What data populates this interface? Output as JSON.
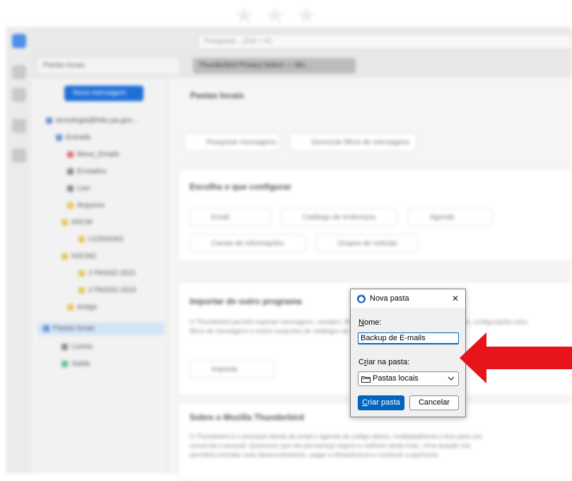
{
  "dialog": {
    "title": "Nova pasta",
    "close_symbol": "✕",
    "name_label": {
      "accesskey": "N",
      "rest": "ome:"
    },
    "name_value": "Backup de E-mails",
    "folder_label": {
      "pre": "C",
      "accesskey": "r",
      "post": "iar na pasta:"
    },
    "folder_selected": "Pastas locais",
    "create_button": {
      "accesskey": "C",
      "rest": "riar pasta"
    },
    "cancel_button": "Cancelar"
  },
  "background": {
    "search_placeholder": "Pesquisar... (Ctrl + K)",
    "tabs": [
      "Pastas locais",
      "Thunderbird Privacy Notice — Mo..."
    ],
    "new_message_button": "Nova mensagem",
    "folders": [
      "tecnologia@fnbu.pa.gov...",
      "Entrada",
      "Meus_Emails",
      "Enviados",
      "Lixo",
      "Arquivos",
      "NSCM",
      "LICENSAS",
      "NSCM2",
      "2 PASSO 2021",
      "2 PASSO 2023",
      "Antigo",
      "Pastas locais",
      "Lixeira",
      "Saída"
    ],
    "header_title": "Pastas locais",
    "search_messages": "Pesquisar mensagens",
    "message_filters": "Gerenciar filtros de mensagens",
    "setup_heading": "Escolha o que configurar",
    "setup_items": [
      "Email",
      "Catálogo de endereços",
      "Agenda",
      "Canais de informações",
      "Grupos de notícias"
    ],
    "import_heading": "Importar de outro programa",
    "import_text": "O Thunderbird permite importar mensagens, contatos, filtros, assinaturas de canais de informações, configurações e/ou filtros de mensagens e outros conjuntos de catálogos de endereços.",
    "import_button": "Importar",
    "about_heading": "Sobre o Mozilla Thunderbird",
    "about_text": "O Thunderbird é o principal cliente de email e agenda de código aberto, multiplataforma e livre para uso comercial e pessoal. Queremos que ele permaneça seguro e melhore ainda mais. Uma doação nos permitirá contratar mais desenvolvedores, pagar a infraestrutura e continuar a aprimorar."
  },
  "colors": {
    "accent": "#0067c0",
    "arrow": "#e8141b",
    "new_message_button": "#1f6fd8"
  },
  "icons": [
    "thunderbird-icon",
    "close-icon",
    "folder-icon",
    "chevron-down-icon",
    "red-arrow"
  ]
}
